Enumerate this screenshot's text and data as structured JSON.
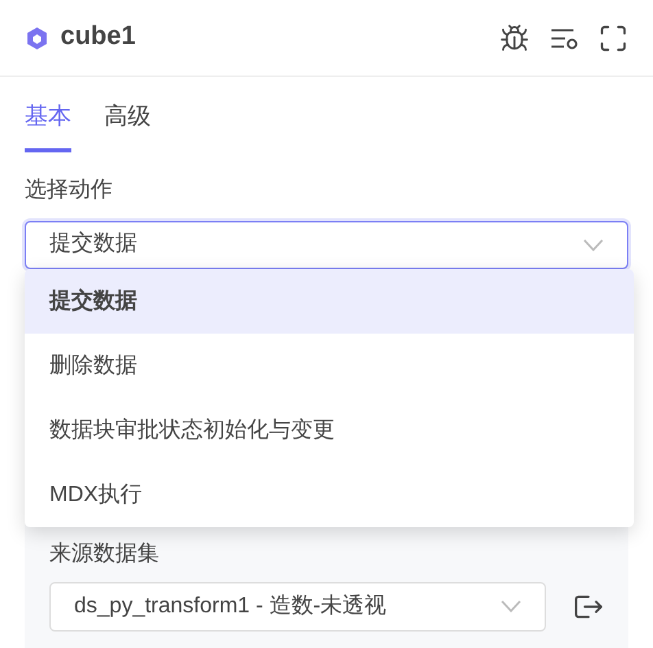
{
  "header": {
    "title": "cube1"
  },
  "tabs": [
    {
      "label": "基本",
      "selected": true
    },
    {
      "label": "高级",
      "selected": false
    }
  ],
  "action": {
    "label": "选择动作",
    "value": "提交数据",
    "expanded": true,
    "options": [
      {
        "label": "提交数据",
        "selected": true
      },
      {
        "label": "删除数据",
        "selected": false
      },
      {
        "label": "数据块审批状态初始化与变更",
        "selected": false
      },
      {
        "label": "MDX执行",
        "selected": false
      }
    ]
  },
  "source": {
    "label": "来源数据集",
    "value": "ds_py_transform1 - 造数-未透视"
  }
}
